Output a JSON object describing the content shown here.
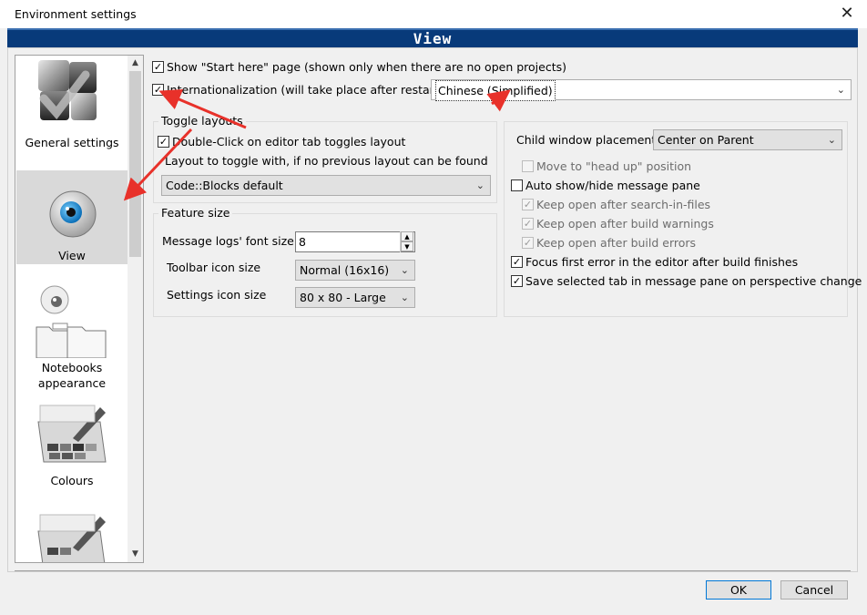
{
  "window": {
    "title": "Environment settings",
    "close_glyph": "✕"
  },
  "banner": {
    "title": "View"
  },
  "sidebar": {
    "items": [
      {
        "label": "General settings",
        "icon": "general-settings-icon"
      },
      {
        "label": "View",
        "icon": "eye-icon",
        "selected": true
      },
      {
        "label": "Notebooks appearance",
        "icon": "notebooks-icon"
      },
      {
        "label": "Colours",
        "icon": "palette-icon"
      },
      {
        "label": "",
        "icon": "palette-icon"
      }
    ]
  },
  "options": {
    "show_start_here": {
      "label": "Show \"Start here\" page (shown only when there are no open projects)",
      "checked": true
    },
    "internationalization": {
      "label": "Internationalization (will take place after restart)",
      "checked": true,
      "value": "Chinese (Simplified)"
    }
  },
  "toggle_layouts": {
    "title": "Toggle layouts",
    "double_click": {
      "label": "Double-Click on editor tab toggles layout",
      "checked": true
    },
    "layout_label": "Layout to toggle with, if no previous layout can be found",
    "layout_value": "Code::Blocks default"
  },
  "feature_size": {
    "title": "Feature size",
    "font_size_label": "Message logs' font size:",
    "font_size_value": "8",
    "toolbar_icon_label": "Toolbar icon size",
    "toolbar_icon_value": "Normal (16x16)",
    "settings_icon_label": "Settings icon size",
    "settings_icon_value": "80 x 80 - Large"
  },
  "child_window": {
    "placement_label": "Child window placement",
    "placement_value": "Center on Parent",
    "move_head_up": {
      "label": "Move to \"head up\" position",
      "checked": false,
      "enabled": false
    },
    "auto_show_hide": {
      "label": "Auto show/hide message pane",
      "checked": false
    },
    "keep_open_search": {
      "label": "Keep open after search-in-files",
      "checked": true,
      "enabled": false
    },
    "keep_open_warnings": {
      "label": "Keep open after build warnings",
      "checked": true,
      "enabled": false
    },
    "keep_open_errors": {
      "label": "Keep open after build errors",
      "checked": true,
      "enabled": false
    },
    "focus_first_error": {
      "label": "Focus first error in the editor after build finishes",
      "checked": true
    },
    "save_selected_tab": {
      "label": "Save selected tab in message pane on perspective change",
      "checked": true
    }
  },
  "buttons": {
    "ok": "OK",
    "cancel": "Cancel"
  },
  "glyphs": {
    "check": "✓",
    "dropdown": "⌄",
    "up": "▲",
    "down": "▼"
  },
  "colors": {
    "banner": "#083a7a",
    "annotation_arrow": "#e8312a",
    "selected_item": "#d9d9d9"
  }
}
